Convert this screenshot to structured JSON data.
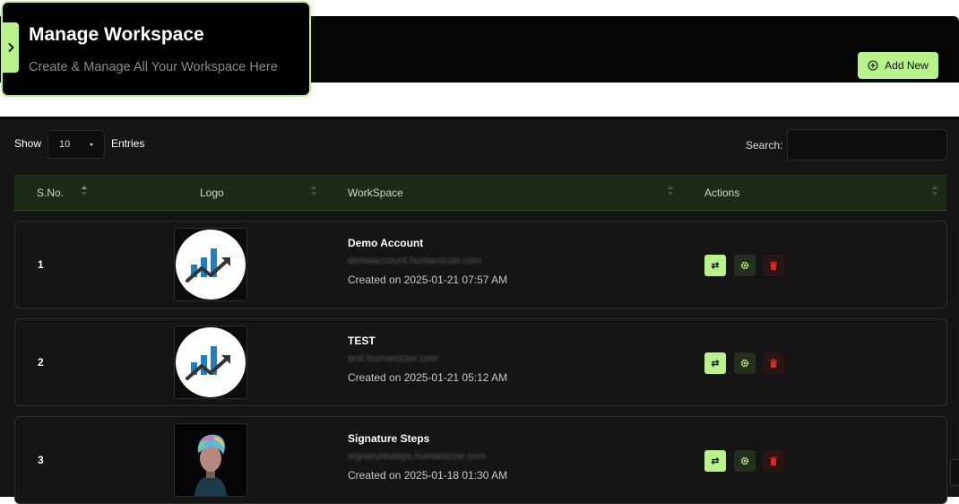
{
  "header": {
    "title": "Manage Workspace",
    "subtitle": "Create & Manage All Your Workspace Here",
    "add_button_label": "Add New",
    "icons": {
      "toggle": "chevron-right-icon",
      "add": "plus-circle-icon"
    }
  },
  "table_controls": {
    "show_label": "Show",
    "entries_value": "10",
    "entries_label": "Entries",
    "search_label": "Search:",
    "search_value": ""
  },
  "columns": [
    "S.No.",
    "Logo",
    "WorkSpace",
    "Actions"
  ],
  "rows": [
    {
      "sno": "1",
      "name": "Demo Account",
      "domain": "demoaccount.humanizzer.com",
      "created": "Created on 2025-01-21 07:57 AM",
      "logo": "chart-growth-logo"
    },
    {
      "sno": "2",
      "name": "TEST",
      "domain": "test.humanizzer.com",
      "created": "Created on 2025-01-21 05:12 AM",
      "logo": "chart-growth-logo"
    },
    {
      "sno": "3",
      "name": "Signature Steps",
      "domain": "signaturesteps.humanizzer.com",
      "created": "Created on 2025-01-18 01:30 AM",
      "logo": "portrait-avatar-logo"
    }
  ],
  "action_icons": [
    "switch-icon",
    "gear-icon",
    "trash-icon"
  ],
  "colors": {
    "accent": "#b8f28a",
    "header_row": "#1d2a16",
    "panel": "#151515",
    "danger": "#e02424"
  }
}
